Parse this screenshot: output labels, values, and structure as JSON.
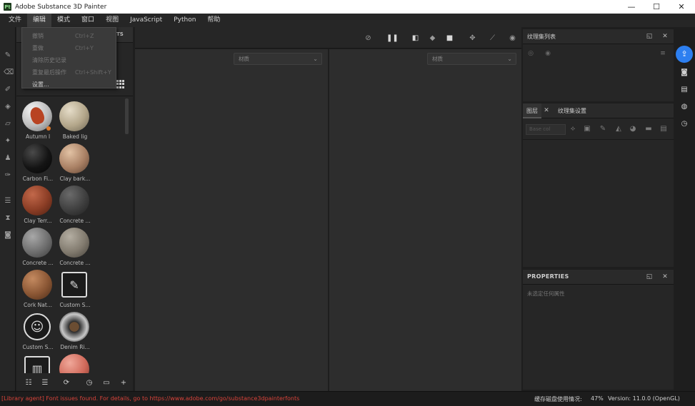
{
  "window": {
    "app_icon": "Pt",
    "title": "Adobe Substance 3D Painter",
    "minimize": "—",
    "maximize": "☐",
    "close": "✕"
  },
  "menu": {
    "items": [
      {
        "label": "文件"
      },
      {
        "label": "编辑"
      },
      {
        "label": "模式"
      },
      {
        "label": "窗口"
      },
      {
        "label": "视图"
      },
      {
        "label": "JavaScript"
      },
      {
        "label": "Python"
      },
      {
        "label": "帮助"
      }
    ]
  },
  "edit_dropdown": {
    "items": [
      {
        "label": "撤销",
        "shortcut": "Ctrl+Z"
      },
      {
        "label": "重做",
        "shortcut": "Ctrl+Y"
      },
      {
        "label": "清除历史记录",
        "shortcut": ""
      },
      {
        "label": "重复最后操作",
        "shortcut": "Ctrl+Shift+Y"
      },
      {
        "label": "设置...",
        "shortcut": ""
      }
    ]
  },
  "shelf": {
    "tab_label": "TS",
    "materials": [
      {
        "label": "Autumn l"
      },
      {
        "label": "Baked lig"
      },
      {
        "label": "Carbon Fi..."
      },
      {
        "label": "Clay bark..."
      },
      {
        "label": "Clay Terr..."
      },
      {
        "label": "Concrete ..."
      },
      {
        "label": "Concrete ..."
      },
      {
        "label": "Concrete ..."
      },
      {
        "label": "Cork Nat..."
      },
      {
        "label": "Custom S..."
      },
      {
        "label": "Custom S..."
      },
      {
        "label": "Denim Ri..."
      },
      {
        "label": ""
      },
      {
        "label": ""
      }
    ]
  },
  "viewport": {
    "left_select": "材质",
    "right_select": "材质"
  },
  "texture_set_list": {
    "title": "纹理集列表"
  },
  "layers": {
    "tab_layers": "图层",
    "tab_settings": "纹理集设置",
    "blend_select": "Base col"
  },
  "properties": {
    "title": "PROPERTIES",
    "empty_text": "未选定任何属性"
  },
  "status": {
    "message": "[Library agent] Font issues found. For details, go to https://www.adobe.com/go/substance3dpainterfonts",
    "disk_label": "缓存磁盘使用情况:",
    "disk_value": "47%",
    "version": "Version: 11.0.0 (OpenGL)"
  },
  "colors": {
    "accent": "#2d7ff0",
    "status_error": "#d9433a"
  }
}
